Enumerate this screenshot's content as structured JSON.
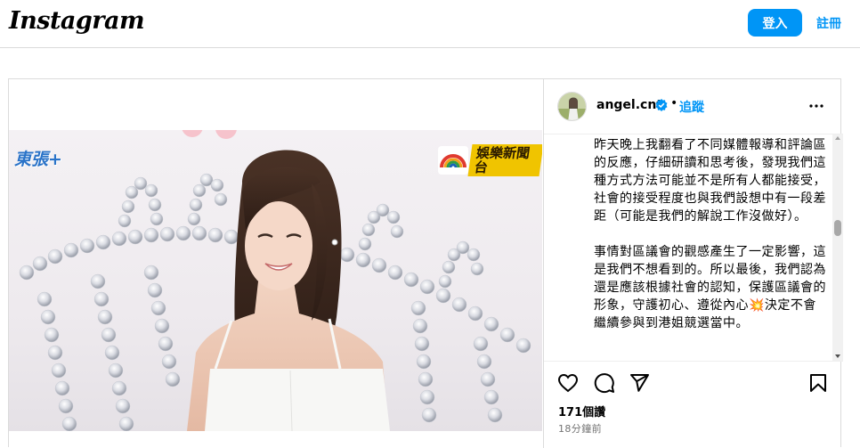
{
  "header": {
    "logo_text": "Instagram",
    "login_label": "登入",
    "signup_label": "註冊"
  },
  "post": {
    "author": {
      "username": "angel.cnt",
      "separator": "•",
      "follow_label": "追蹤"
    },
    "caption": "昨天晚上我翻看了不同媒體報導和評論區的反應，仔細研讀和思考後，發現我們這種方式方法可能並不是所有人都能接受，社會的接受程度也與我們設想中有一段差距（可能是我們的解說工作沒做好）。\n\n事情對區議會的觀感產生了一定影響，這是我們不想看到的。所以最後，我們認為還是應該根據社會的認知，保護區議會的形象，守護初心、遵從內心💥決定不會繼續參與到港姐競選當中。",
    "likes_text": "171個讚",
    "time_text": "18分鐘前",
    "video": {
      "watermark_left": "東張+",
      "watermark_right": "娛樂新聞台"
    }
  },
  "colors": {
    "accent": "#0095f6",
    "border": "#dbdbdb",
    "secondary_text": "#737373"
  },
  "icons": [
    "heart-icon",
    "comment-icon",
    "share-icon",
    "bookmark-icon",
    "more-icon",
    "verified-icon"
  ]
}
